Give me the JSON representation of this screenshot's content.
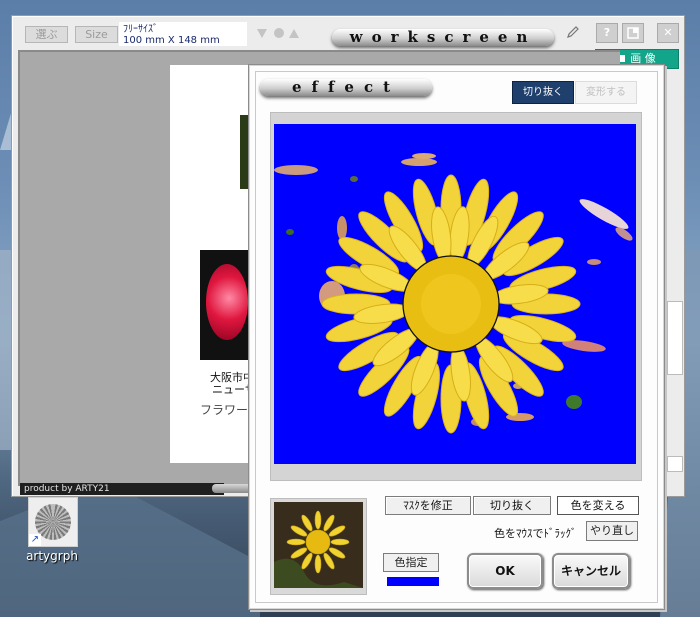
{
  "workscreen": {
    "title": "workscreen",
    "select_button": "選ぶ",
    "size_button": "Size",
    "size_mode": "ﾌﾘｰｻｲｽﾞ",
    "size_dims": "100 mm  X  148 mm",
    "help_button": "?",
    "close_button": "✕",
    "image_tab": "画 像",
    "page_caption_line1": "大阪市中",
    "page_caption_line2": "ニューサ",
    "page_caption_line3": "フラワー",
    "footer": "product by ARTY21"
  },
  "desktop": {
    "icon_label": "artygrph"
  },
  "effect": {
    "title": "effect",
    "mode_crop": "切り抜く",
    "mode_transform": "変形する",
    "fix_mask_button": "ﾏｽｸを修正",
    "crop_button": "切り抜く",
    "change_color_button": "色を変える",
    "drag_hint": "色をﾏｳｽでﾄﾞﾗｯｸﾞ",
    "redo_button": "やり直し",
    "color_pick_button": "色指定",
    "ok_button": "OK",
    "cancel_button": "キャンセル",
    "mask_color": "#0000ff"
  }
}
